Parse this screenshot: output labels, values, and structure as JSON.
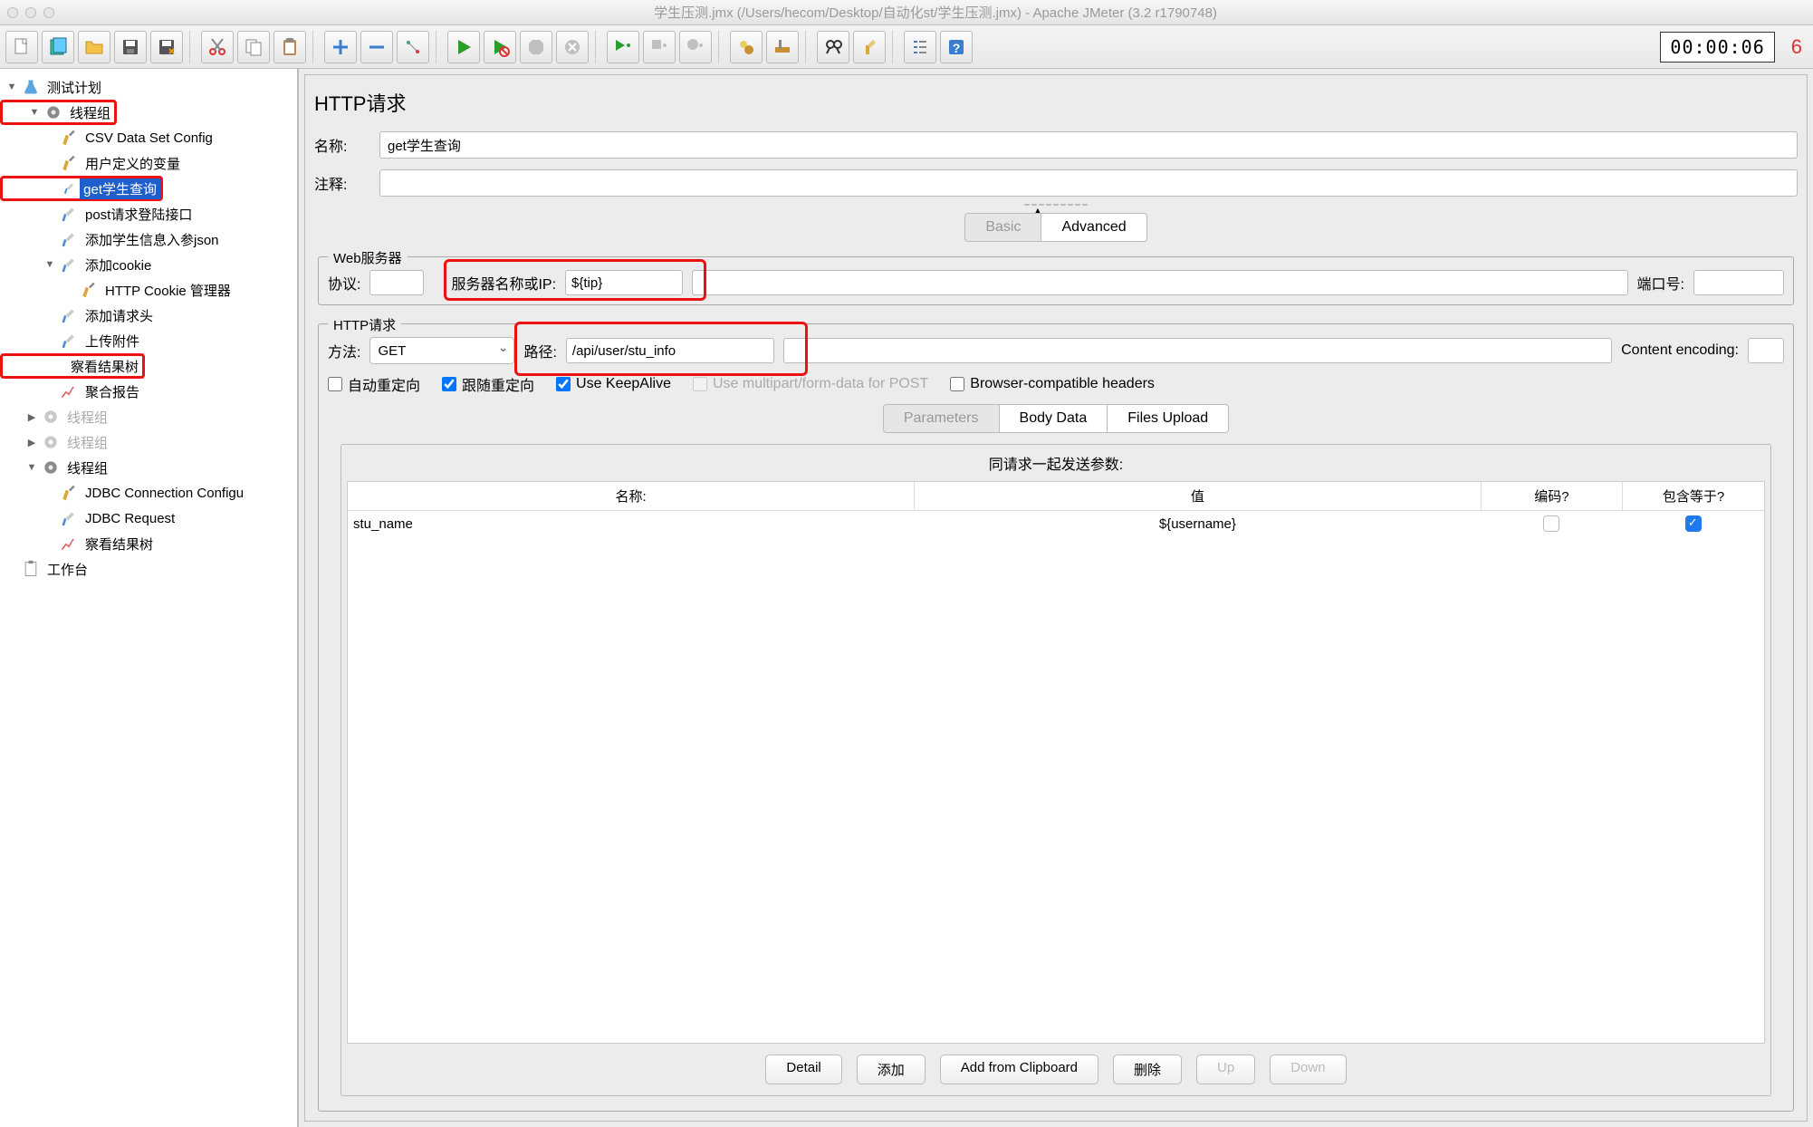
{
  "title": "学生压测.jmx (/Users/hecom/Desktop/自动化st/学生压测.jmx) - Apache JMeter (3.2 r1790748)",
  "timer": "00:00:06",
  "thread_count": "6",
  "tree": {
    "root": "测试计划",
    "tg1": "线程组",
    "items1": [
      "CSV Data Set Config",
      "用户定义的变量",
      "get学生查询",
      "post请求登陆接口",
      "添加学生信息入参json",
      "添加cookie",
      "HTTP Cookie 管理器",
      "添加请求头",
      "上传附件",
      "察看结果树",
      "聚合报告"
    ],
    "tg2": "线程组",
    "tg3": "线程组",
    "tg4": "线程组",
    "items4": [
      "JDBC Connection Configu",
      "JDBC Request",
      "察看结果树"
    ],
    "workbench": "工作台"
  },
  "panel": {
    "title": "HTTP请求",
    "name_label": "名称:",
    "name_value": "get学生查询",
    "comment_label": "注释:",
    "comment_value": "",
    "tabs": {
      "basic": "Basic",
      "advanced": "Advanced"
    },
    "web": {
      "legend": "Web服务器",
      "protocol_label": "协议:",
      "protocol_value": "",
      "server_label": "服务器名称或IP:",
      "server_value": "${tip}",
      "port_label": "端口号:",
      "port_value": ""
    },
    "http": {
      "legend": "HTTP请求",
      "method_label": "方法:",
      "method_value": "GET",
      "path_label": "路径:",
      "path_value": "/api/user/stu_info",
      "enc_label": "Content encoding:",
      "enc_value": "",
      "chk_auto": "自动重定向",
      "chk_follow": "跟随重定向",
      "chk_keep": "Use KeepAlive",
      "chk_multi": "Use multipart/form-data for POST",
      "chk_browser": "Browser-compatible headers"
    },
    "params": {
      "tabs": {
        "p": "Parameters",
        "b": "Body Data",
        "f": "Files Upload"
      },
      "header": "同请求一起发送参数:",
      "cols": {
        "name": "名称:",
        "value": "值",
        "enc": "编码?",
        "eq": "包含等于?"
      },
      "rows": [
        {
          "name": "stu_name",
          "value": "${username}",
          "enc": false,
          "eq": true
        }
      ],
      "btns": {
        "detail": "Detail",
        "add": "添加",
        "clip": "Add from Clipboard",
        "del": "删除",
        "up": "Up",
        "down": "Down"
      }
    }
  }
}
